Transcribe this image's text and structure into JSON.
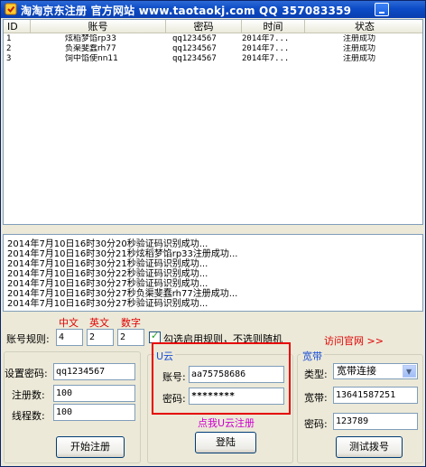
{
  "window": {
    "title": "淘淘京东注册 官方网站 www.taotaokj.com QQ 357083359"
  },
  "table": {
    "headers": [
      "ID",
      "账号",
      "密码",
      "时间",
      "状态"
    ],
    "rows": [
      {
        "id": "1",
        "account": "炫稻梦馅rp33",
        "password": "qq1234567",
        "time": "2014年7...",
        "status": "注册成功"
      },
      {
        "id": "2",
        "account": "负渠斐蠢rh77",
        "password": "qq1234567",
        "time": "2014年7...",
        "status": "注册成功"
      },
      {
        "id": "3",
        "account": "饲中馅使nn11",
        "password": "qq1234567",
        "time": "2014年7...",
        "status": "注册成功"
      }
    ]
  },
  "log": {
    "lines": [
      "2014年7月10日16时30分20秒验证码识别成功...",
      "2014年7月10日16时30分21秒炫稻梦馅rp33注册成功...",
      "2014年7月10日16时30分21秒验证码识别成功...",
      "2014年7月10日16时30分22秒验证码识别成功...",
      "2014年7月10日16时30分27秒验证码识别成功...",
      "2014年7月10日16时30分27秒负渠斐蠢rh77注册成功...",
      "2014年7月10日16时30分27秒验证码识别成功..."
    ]
  },
  "rules": {
    "label": "账号规则:",
    "col_chinese": "中文",
    "col_english": "英文",
    "col_digits": "数字",
    "chinese_count": "4",
    "english_count": "2",
    "digit_count": "2",
    "checkbox_label": "勾选启用规则，不选则随机",
    "checked": true,
    "visit_site": "访问官网 >>"
  },
  "settings": {
    "password_label": "设置密码:",
    "password_value": "qq1234567",
    "register_count_label": "注册数:",
    "register_count_value": "100",
    "threads_label": "线程数:",
    "threads_value": "100",
    "start_button": "开始注册"
  },
  "cloud": {
    "group_title": "U云",
    "account_label": "账号:",
    "account_value": "aa75758686",
    "password_label": "密码:",
    "password_value": "********",
    "register_link": "点我U云注册",
    "login_button": "登陆"
  },
  "broadband": {
    "group_title": "宽带",
    "type_label": "类型:",
    "type_value": "宽带连接",
    "bb_account_label": "宽带:",
    "bb_account_value": "13641587251",
    "bb_password_label": "密码:",
    "bb_password_value": "123789",
    "test_button": "测试拨号"
  },
  "colors": {
    "title_bar": "#0c4bc6",
    "highlight_red": "#e60000",
    "link_magenta": "#cc00cc",
    "group_title_blue": "#1a4fd6"
  }
}
